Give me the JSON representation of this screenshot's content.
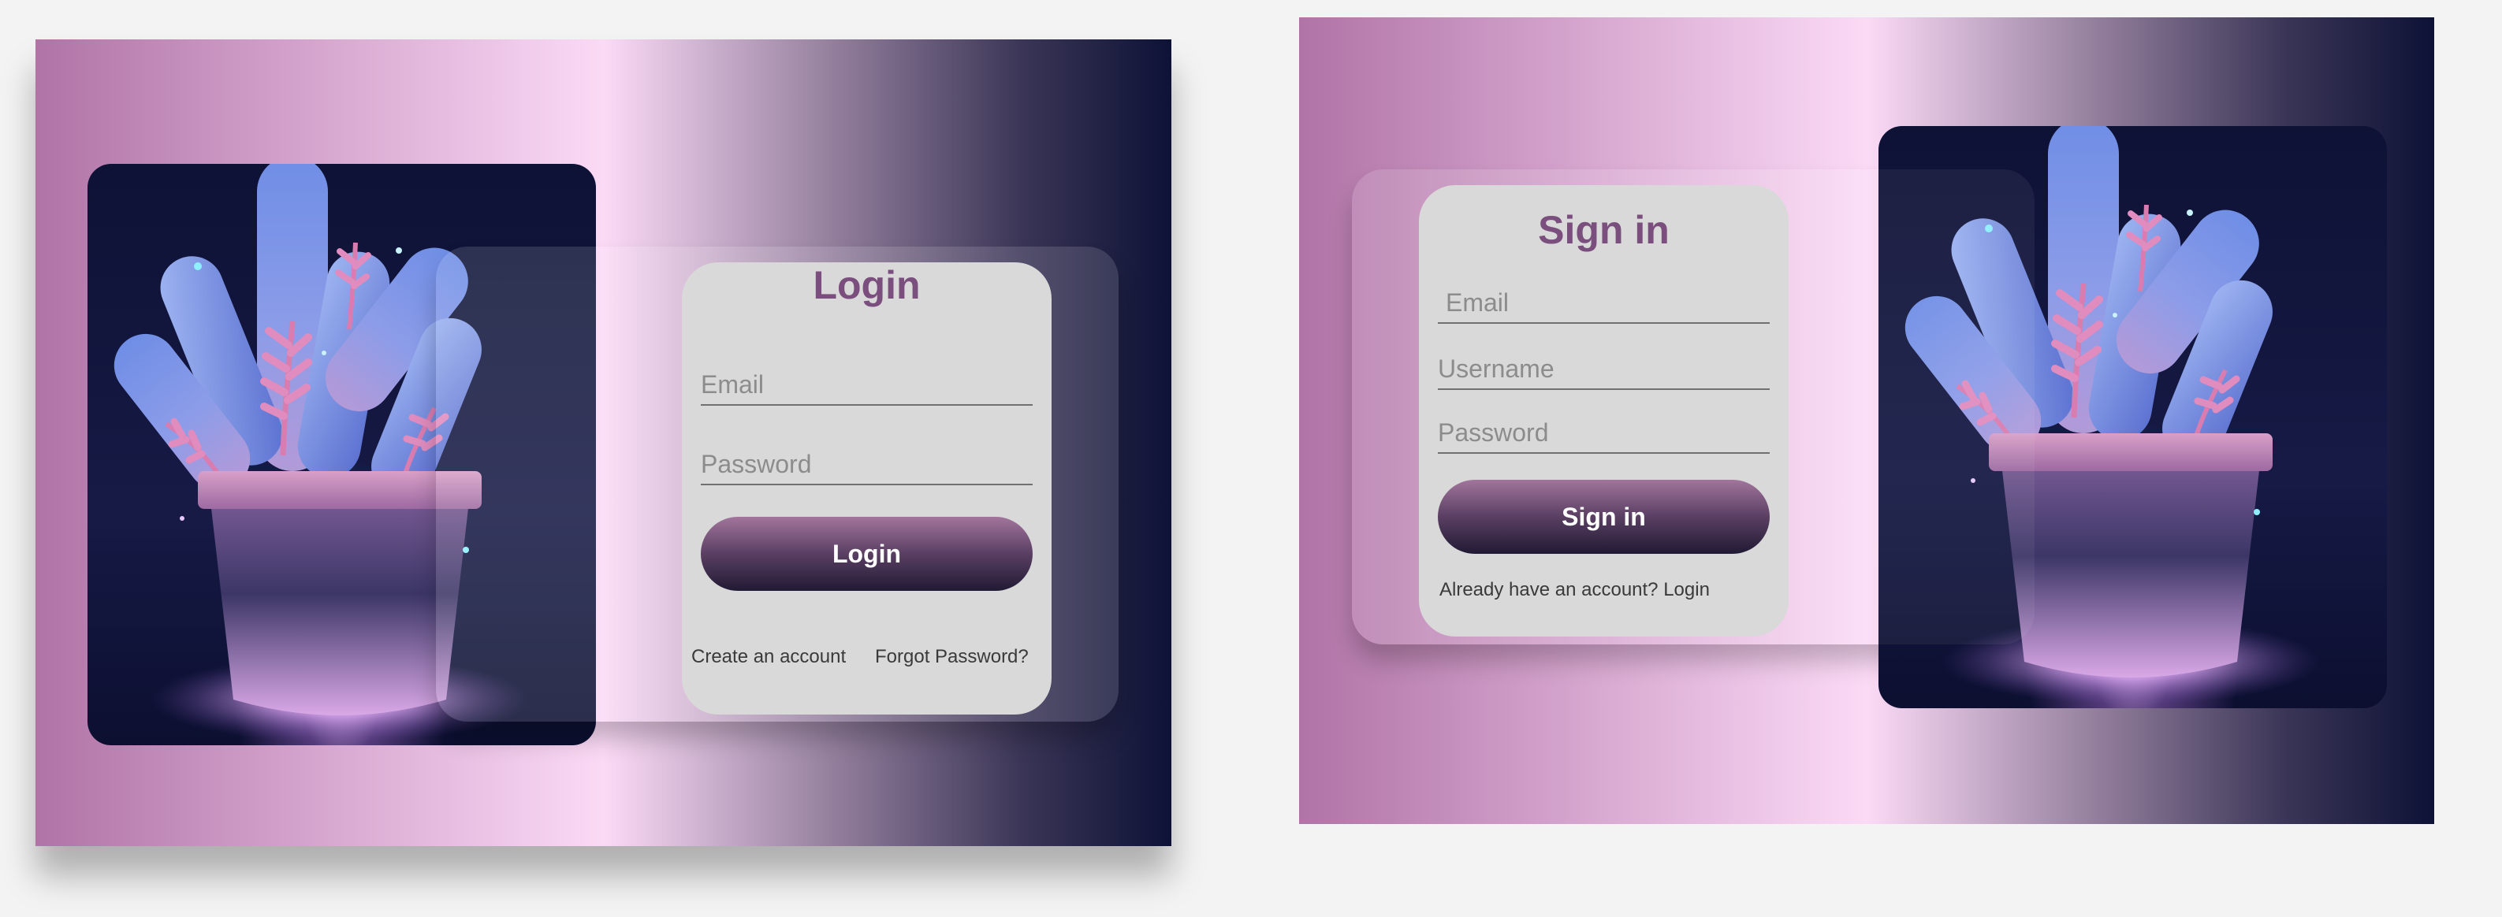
{
  "login_card": {
    "title": "Login",
    "email": {
      "placeholder": "Email"
    },
    "password": {
      "placeholder": "Password"
    },
    "button_label": "Login",
    "create_account_link": "Create an account",
    "forgot_password_link": "Forgot Password?"
  },
  "signin_card": {
    "title": "Sign in",
    "email": {
      "placeholder": "Email"
    },
    "username": {
      "placeholder": "Username"
    },
    "password": {
      "placeholder": "Password"
    },
    "button_label": "Sign in",
    "footer_text": "Already have an account? Login"
  },
  "colors": {
    "title": "#7a4e7d",
    "form_background": "#d9d9d9",
    "button_top": "#a2759c",
    "button_bottom": "#211a34",
    "gradient_pink": "#fbdaf6",
    "gradient_navy": "#0d1236",
    "page_background": "#f3f3f3"
  }
}
